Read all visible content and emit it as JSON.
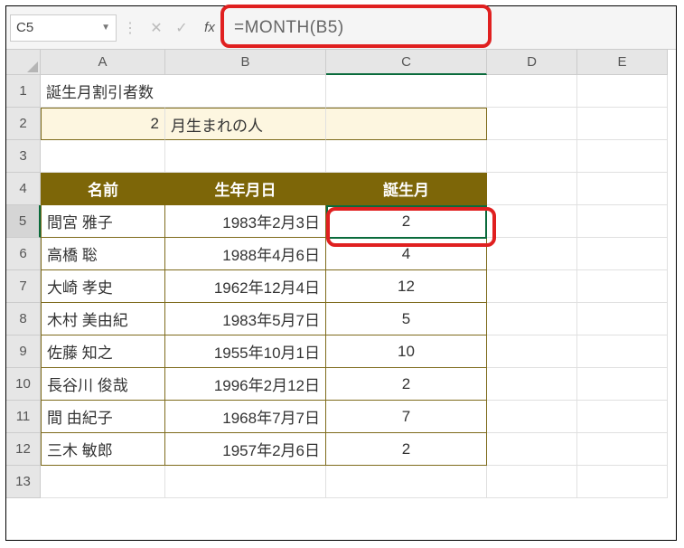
{
  "namebox": "C5",
  "formula": "=MONTH(B5)",
  "fx_label": "fx",
  "col_headers": [
    "A",
    "B",
    "C",
    "D",
    "E"
  ],
  "row_headers": [
    "1",
    "2",
    "3",
    "4",
    "5",
    "6",
    "7",
    "8",
    "9",
    "10",
    "11",
    "12",
    "13"
  ],
  "title": "誕生月割引者数",
  "filter": {
    "month_value": "2",
    "suffix": "月生まれの人"
  },
  "table": {
    "headers": [
      "名前",
      "生年月日",
      "誕生月"
    ],
    "rows": [
      {
        "name": "間宮 雅子",
        "dob": "1983年2月3日",
        "month": "2"
      },
      {
        "name": "高橋 聡",
        "dob": "1988年4月6日",
        "month": "4"
      },
      {
        "name": "大崎 孝史",
        "dob": "1962年12月4日",
        "month": "12"
      },
      {
        "name": "木村 美由紀",
        "dob": "1983年5月7日",
        "month": "5"
      },
      {
        "name": "佐藤 知之",
        "dob": "1955年10月1日",
        "month": "10"
      },
      {
        "name": "長谷川 俊哉",
        "dob": "1996年2月12日",
        "month": "2"
      },
      {
        "name": "間 由紀子",
        "dob": "1968年7月7日",
        "month": "7"
      },
      {
        "name": "三木 敏郎",
        "dob": "1957年2月6日",
        "month": "2"
      }
    ]
  }
}
